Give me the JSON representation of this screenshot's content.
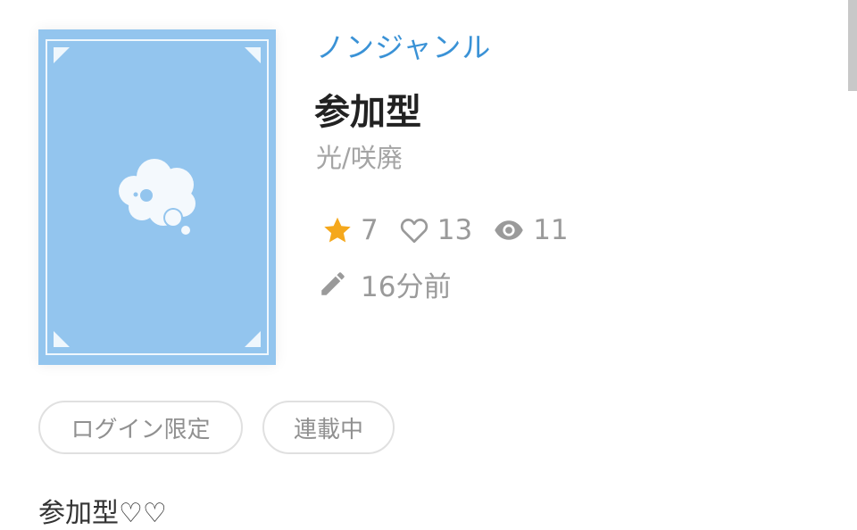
{
  "work": {
    "genre": "ノンジャンル",
    "title": "参加型",
    "author": "光/咲廃",
    "stats": {
      "stars": "7",
      "likes": "13",
      "views": "11"
    },
    "updated": "16分前",
    "tags": [
      "ログイン限定",
      "連載中"
    ],
    "description_preview": "参加型♡♡"
  },
  "colors": {
    "cover_bg": "#93c5ee",
    "genre_link": "#3a92d6",
    "star": "#f5a81c",
    "muted_text": "#9a9a9a"
  },
  "icons": {
    "cover": "thought-bubble-icon",
    "stars": "star-icon",
    "likes": "heart-outline-icon",
    "views": "eye-icon",
    "updated": "pencil-icon"
  }
}
